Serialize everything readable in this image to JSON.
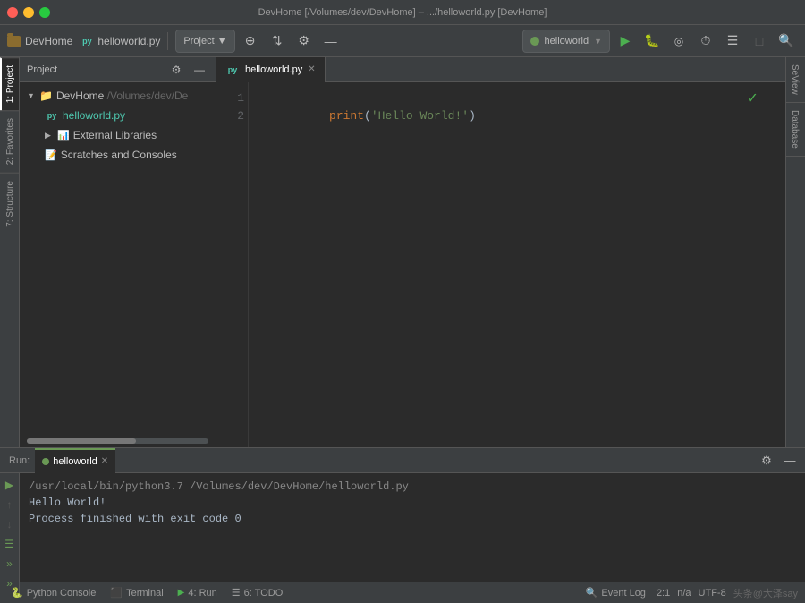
{
  "titleBar": {
    "title": "DevHome [/Volumes/dev/DevHome] – .../helloworld.py [DevHome]",
    "trafficLights": [
      "close",
      "minimize",
      "maximize"
    ]
  },
  "toolbar": {
    "devhome": "DevHome",
    "filename": "helloworld.py",
    "project": "Project ▼",
    "run_config": "helloworld",
    "icons": {
      "run": "▶",
      "debug": "🐛",
      "coverage": "◎",
      "profile": "⏱",
      "rerun": "↻",
      "build": "≡",
      "stop": "□",
      "search": "🔍"
    }
  },
  "sidebar": {
    "left_tabs": [
      {
        "id": "project",
        "label": "1: Project",
        "active": true
      },
      {
        "id": "favorites",
        "label": "2: Favorites",
        "active": false
      },
      {
        "id": "structure",
        "label": "7: Structure",
        "active": false
      }
    ]
  },
  "projectPanel": {
    "header": "Project",
    "tree": [
      {
        "level": 0,
        "type": "folder",
        "name": "DevHome /Volumes/dev/De",
        "open": true,
        "selected": false
      },
      {
        "level": 1,
        "type": "pyfile",
        "name": "helloworld.py",
        "open": false,
        "selected": false
      },
      {
        "level": 1,
        "type": "folder",
        "name": "External Libraries",
        "open": false,
        "selected": false
      },
      {
        "level": 1,
        "type": "scratch",
        "name": "Scratches and Consoles",
        "open": false,
        "selected": false
      }
    ]
  },
  "editor": {
    "tab": "helloworld.py",
    "lines": [
      {
        "num": 1,
        "code": "print('Hello World!')"
      },
      {
        "num": 2,
        "code": ""
      }
    ]
  },
  "rightSidebar": {
    "tabs": [
      {
        "id": "seview",
        "label": "SeView"
      },
      {
        "id": "database",
        "label": "Database"
      }
    ]
  },
  "bottomPanel": {
    "run_tab": "helloworld",
    "output": [
      "/usr/local/bin/python3.7 /Volumes/dev/DevHome/helloworld.py",
      "Hello World!",
      "",
      "Process finished with exit code 0"
    ]
  },
  "statusBar": {
    "python_console": "Python Console",
    "terminal": "Terminal",
    "run": "4: Run",
    "todo": "6: TODO",
    "event_log": "Event Log",
    "position": "2:1",
    "info": "n/a",
    "encoding": "UTF-8",
    "watermark": "头条@大泽say"
  }
}
